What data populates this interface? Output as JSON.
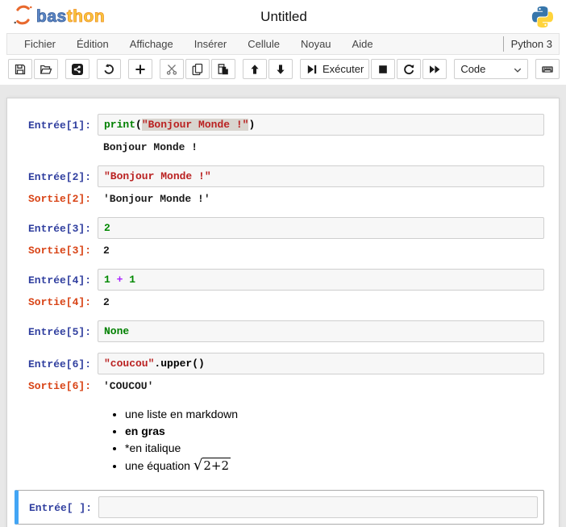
{
  "header": {
    "logo_bas": "bas",
    "logo_thon": "thon",
    "title": "Untitled"
  },
  "menubar": {
    "items": [
      "Fichier",
      "Édition",
      "Affichage",
      "Insérer",
      "Cellule",
      "Noyau",
      "Aide"
    ],
    "kernel": "Python 3"
  },
  "toolbar": {
    "groups": [
      {
        "buttons": [
          {
            "name": "save-button",
            "icon": "save-icon"
          },
          {
            "name": "open-button",
            "icon": "open-folder-icon"
          }
        ]
      },
      {
        "buttons": [
          {
            "name": "share-button",
            "icon": "share-icon"
          }
        ]
      },
      {
        "buttons": [
          {
            "name": "undo-button",
            "icon": "undo-icon"
          }
        ]
      },
      {
        "buttons": [
          {
            "name": "add-cell-button",
            "icon": "plus-icon"
          }
        ]
      },
      {
        "buttons": [
          {
            "name": "cut-cell-button",
            "icon": "cut-icon"
          },
          {
            "name": "copy-cell-button",
            "icon": "copy-icon"
          },
          {
            "name": "paste-cell-button",
            "icon": "paste-icon"
          }
        ]
      },
      {
        "buttons": [
          {
            "name": "move-cell-up-button",
            "icon": "arrow-up-icon"
          },
          {
            "name": "move-cell-down-button",
            "icon": "arrow-down-icon"
          }
        ]
      },
      {
        "buttons": [
          {
            "name": "run-button",
            "icon": "run-icon",
            "label": "Exécuter"
          },
          {
            "name": "stop-button",
            "icon": "stop-icon"
          },
          {
            "name": "restart-kernel-button",
            "icon": "restart-icon"
          },
          {
            "name": "run-all-button",
            "icon": "fast-forward-icon"
          }
        ]
      },
      {
        "select": {
          "name": "cell-type-select",
          "value": "Code"
        }
      },
      {
        "buttons": [
          {
            "name": "keyboard-shortcuts-button",
            "icon": "keyboard-icon"
          }
        ]
      },
      {
        "buttons": [
          {
            "name": "chart-button",
            "icon": "bar-chart-icon"
          }
        ]
      }
    ]
  },
  "colors": {
    "in_prompt": "#303F9F",
    "out_prompt": "#D84315",
    "selected_cell_border": "#42A5F5",
    "keyword": "#008000",
    "string": "#BA2121",
    "number": "#008800",
    "operator": "#AA22FF",
    "selection_bg": "#d9d5cf",
    "logo_blue": "#5b87c7",
    "logo_yellow": "#f8c63e"
  },
  "notebook": {
    "cells": [
      {
        "type": "code",
        "prompt": "Entrée[1]:",
        "source": [
          {
            "text": "print",
            "style": "kw"
          },
          {
            "text": "(",
            "style": "plain"
          },
          {
            "text": "\"Bonjour Monde !\"",
            "style": "str sel"
          },
          {
            "text": ")",
            "style": "plain"
          }
        ],
        "outputs": [
          {
            "kind": "stream",
            "text": "Bonjour Monde !"
          }
        ]
      },
      {
        "type": "code",
        "prompt": "Entrée[2]:",
        "source": [
          {
            "text": "\"Bonjour Monde !\"",
            "style": "str"
          }
        ],
        "outputs": [
          {
            "kind": "result",
            "prompt": "Sortie[2]:",
            "text": "'Bonjour Monde !'"
          }
        ]
      },
      {
        "type": "code",
        "prompt": "Entrée[3]:",
        "source": [
          {
            "text": "2",
            "style": "num"
          }
        ],
        "outputs": [
          {
            "kind": "result",
            "prompt": "Sortie[3]:",
            "text": "2"
          }
        ]
      },
      {
        "type": "code",
        "prompt": "Entrée[4]:",
        "source": [
          {
            "text": "1",
            "style": "num"
          },
          {
            "text": " ",
            "style": "plain"
          },
          {
            "text": "+",
            "style": "op"
          },
          {
            "text": " ",
            "style": "plain"
          },
          {
            "text": "1",
            "style": "num"
          }
        ],
        "outputs": [
          {
            "kind": "result",
            "prompt": "Sortie[4]:",
            "text": "2"
          }
        ]
      },
      {
        "type": "code",
        "prompt": "Entrée[5]:",
        "source": [
          {
            "text": "None",
            "style": "kw"
          }
        ],
        "outputs": []
      },
      {
        "type": "code",
        "prompt": "Entrée[6]:",
        "source": [
          {
            "text": "\"coucou\"",
            "style": "str"
          },
          {
            "text": ".upper()",
            "style": "plain"
          }
        ],
        "outputs": [
          {
            "kind": "result",
            "prompt": "Sortie[6]:",
            "text": "'COUCOU'"
          }
        ]
      },
      {
        "type": "markdown",
        "items": [
          {
            "text": "une liste en markdown"
          },
          {
            "text": "en gras",
            "bold": true
          },
          {
            "text": "*en italique"
          },
          {
            "text": "une équation ",
            "math": "2+2"
          }
        ]
      },
      {
        "type": "code",
        "prompt": "Entrée[ ]:",
        "source": [],
        "outputs": [],
        "selected": true
      }
    ]
  }
}
